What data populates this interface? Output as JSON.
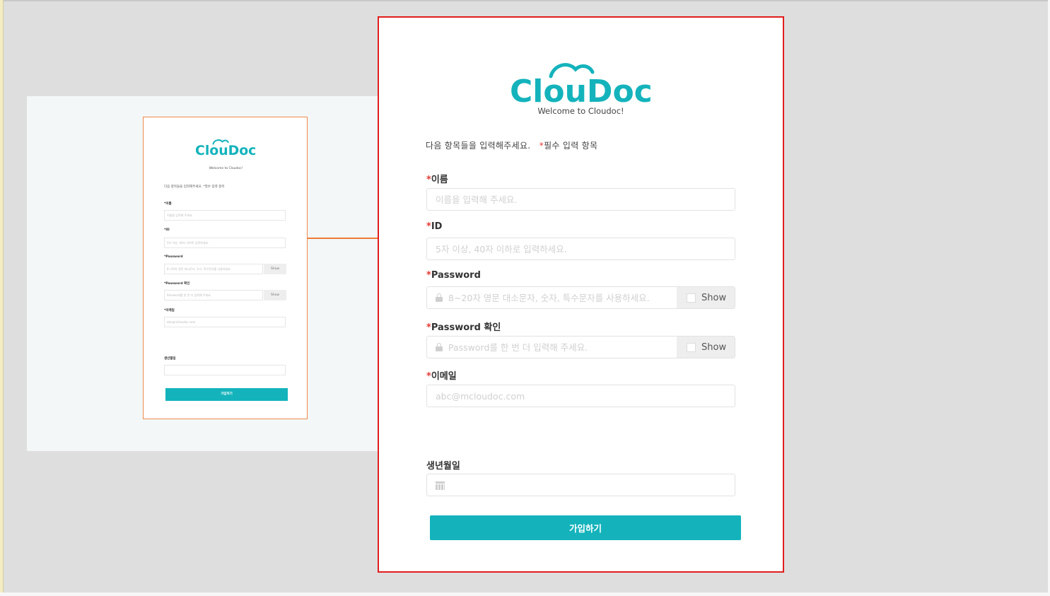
{
  "brand": {
    "logo_text": "ClouDoc",
    "welcome": "Welcome to Cloudoc!",
    "accent_color": "#14b3bc",
    "selection_color": "#e11d1d",
    "connector_color": "#ef7a35"
  },
  "form": {
    "intro_text": "다음 항목들을 입력해주세요.",
    "required_marker": "*",
    "required_note": "필수 입력 항목",
    "fields": {
      "name": {
        "label": "이름",
        "placeholder": "이름을 입력해 주세요."
      },
      "id": {
        "label": "ID",
        "placeholder": "5자 이상, 40자 이하로 입력하세요."
      },
      "password": {
        "label": "Password",
        "placeholder": "8~20자 영문 대소문자, 숫자, 특수문자를 사용하세요.",
        "show_label": "Show"
      },
      "password_confirm": {
        "label": "Password 확인",
        "placeholder": "Password를 한 번 더 입력해 주세요.",
        "show_label": "Show"
      },
      "email": {
        "label": "이메일",
        "placeholder": "abc@mcloudoc.com"
      },
      "birthdate": {
        "label": "생년월일",
        "placeholder": ""
      }
    },
    "submit_label": "가입하기"
  },
  "thumbnail": {
    "intro_text": "다음 항목들을 입력해주세요. *필수 입력 항목",
    "name_label": "*이름",
    "name_placeholder": "이름을 입력해 주세요.",
    "id_label": "*ID",
    "id_placeholder": "5자 이상, 40자 이하로 입력하세요.",
    "password_label": "*Password",
    "password_placeholder": "8~20자 영문 대소문자, 숫자, 특수문자를 사용하세요.",
    "password_confirm_label": "*Password 확인",
    "password_confirm_placeholder": "Password를 한 번 더 입력해 주세요.",
    "show_label": "Show",
    "email_label": "*이메일",
    "email_placeholder": "abc@mcloudoc.com",
    "birthdate_label": "생년월일",
    "submit_label": "가입하기"
  }
}
